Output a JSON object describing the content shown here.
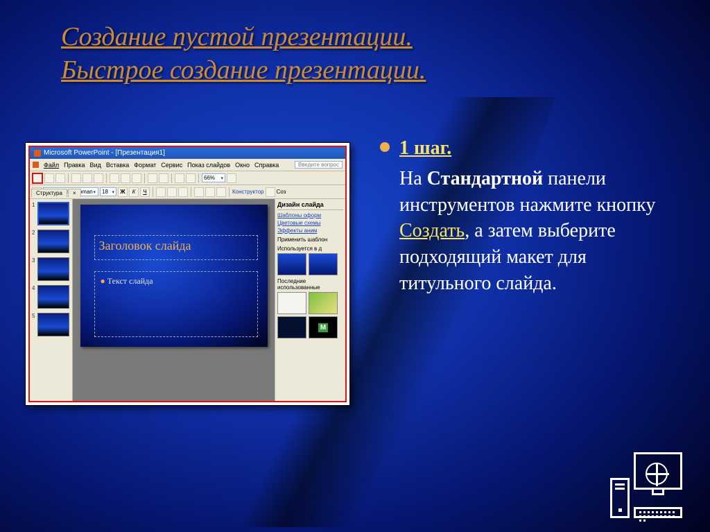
{
  "title": {
    "line1": "Создание пустой презентации.",
    "line2": "Быстрое создание презентации."
  },
  "content": {
    "step_label": "1 шаг.",
    "body_pre": "На ",
    "body_bold1": "Стандартной",
    "body_mid": " панели инструментов нажмите кнопку ",
    "body_link": "Создать",
    "body_post": ", а затем выберите подходящий макет для титульного слайда."
  },
  "ppt": {
    "app_title": "Microsoft PowerPoint - [Презентация1]",
    "menu": [
      "Файл",
      "Правка",
      "Вид",
      "Вставка",
      "Формат",
      "Сервис",
      "Показ слайдов",
      "Окно",
      "Справка"
    ],
    "question_hint": "Введите вопрос",
    "zoom": "66%",
    "font_name": "Times New Roman",
    "font_size": "18",
    "format_buttons": [
      "Ж",
      "К",
      "Ч"
    ],
    "constructor_label": "Конструктор",
    "new_slide_label": "Соз",
    "tabs": {
      "outline": "Структура",
      "slides": "×"
    },
    "thumbs": [
      "1",
      "2",
      "3",
      "4",
      "5"
    ],
    "placeholder_title": "Заголовок слайда",
    "placeholder_body": "Текст слайда",
    "taskpane": {
      "title": "Дизайн слайда",
      "links": [
        "Шаблоны оформ",
        "Цветовые схемы",
        "Эффекты аним"
      ],
      "apply_label": "Применить шаблон",
      "used_label": "Используется в д",
      "recent_label": "Последние использованные"
    }
  }
}
